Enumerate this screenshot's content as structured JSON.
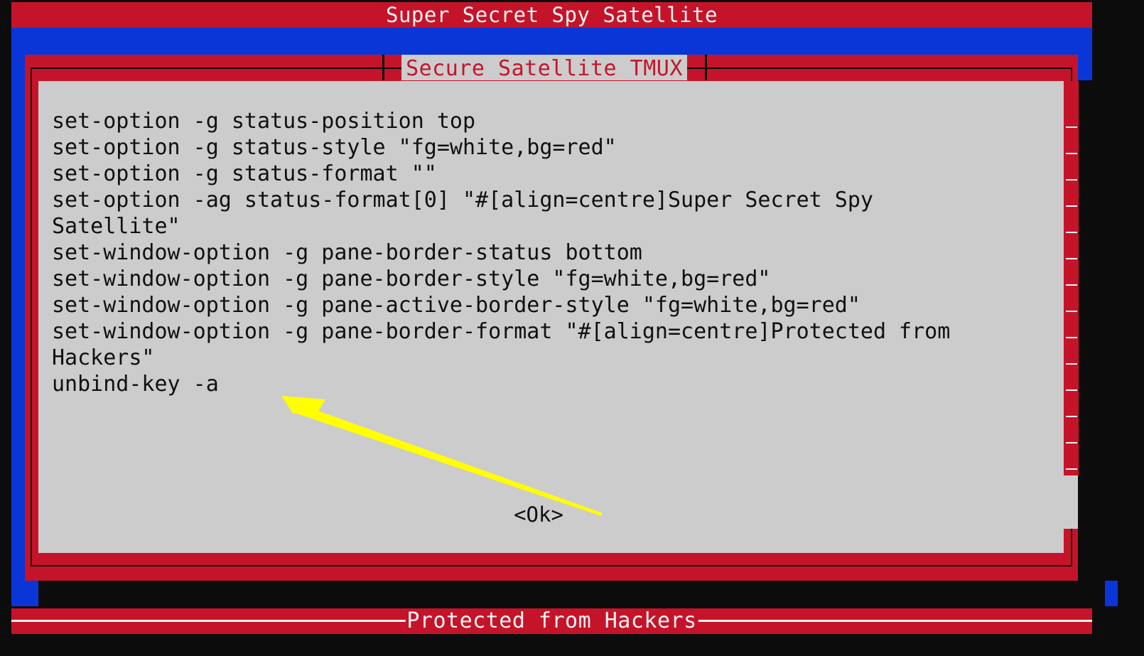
{
  "colors": {
    "status_red": "#c5142a",
    "terminal_blue": "#0a36d8",
    "dialog_gray": "#cccccc",
    "background": "#0c0c0c",
    "arrow_yellow": "#ffff00"
  },
  "status_bar": {
    "title": "Super Secret Spy Satellite"
  },
  "dialog": {
    "title": "Secure Satellite TMUX",
    "lines": [
      "set-option -g status-position top",
      "set-option -g status-style \"fg=white,bg=red\"",
      "set-option -g status-format \"\"",
      "set-option -ag status-format[0] \"#[align=centre]Super Secret Spy",
      "Satellite\"",
      "set-window-option -g pane-border-status bottom",
      "set-window-option -g pane-border-style \"fg=white,bg=red\"",
      "set-window-option -g pane-active-border-style \"fg=white,bg=red\"",
      "set-window-option -g pane-border-format \"#[align=centre]Protected from",
      "Hackers\"",
      "unbind-key -a"
    ],
    "ok_label": "<Ok>"
  },
  "pane_border": {
    "label": "Protected from Hackers"
  },
  "annotation": {
    "icon": "yellow-arrow-icon"
  }
}
